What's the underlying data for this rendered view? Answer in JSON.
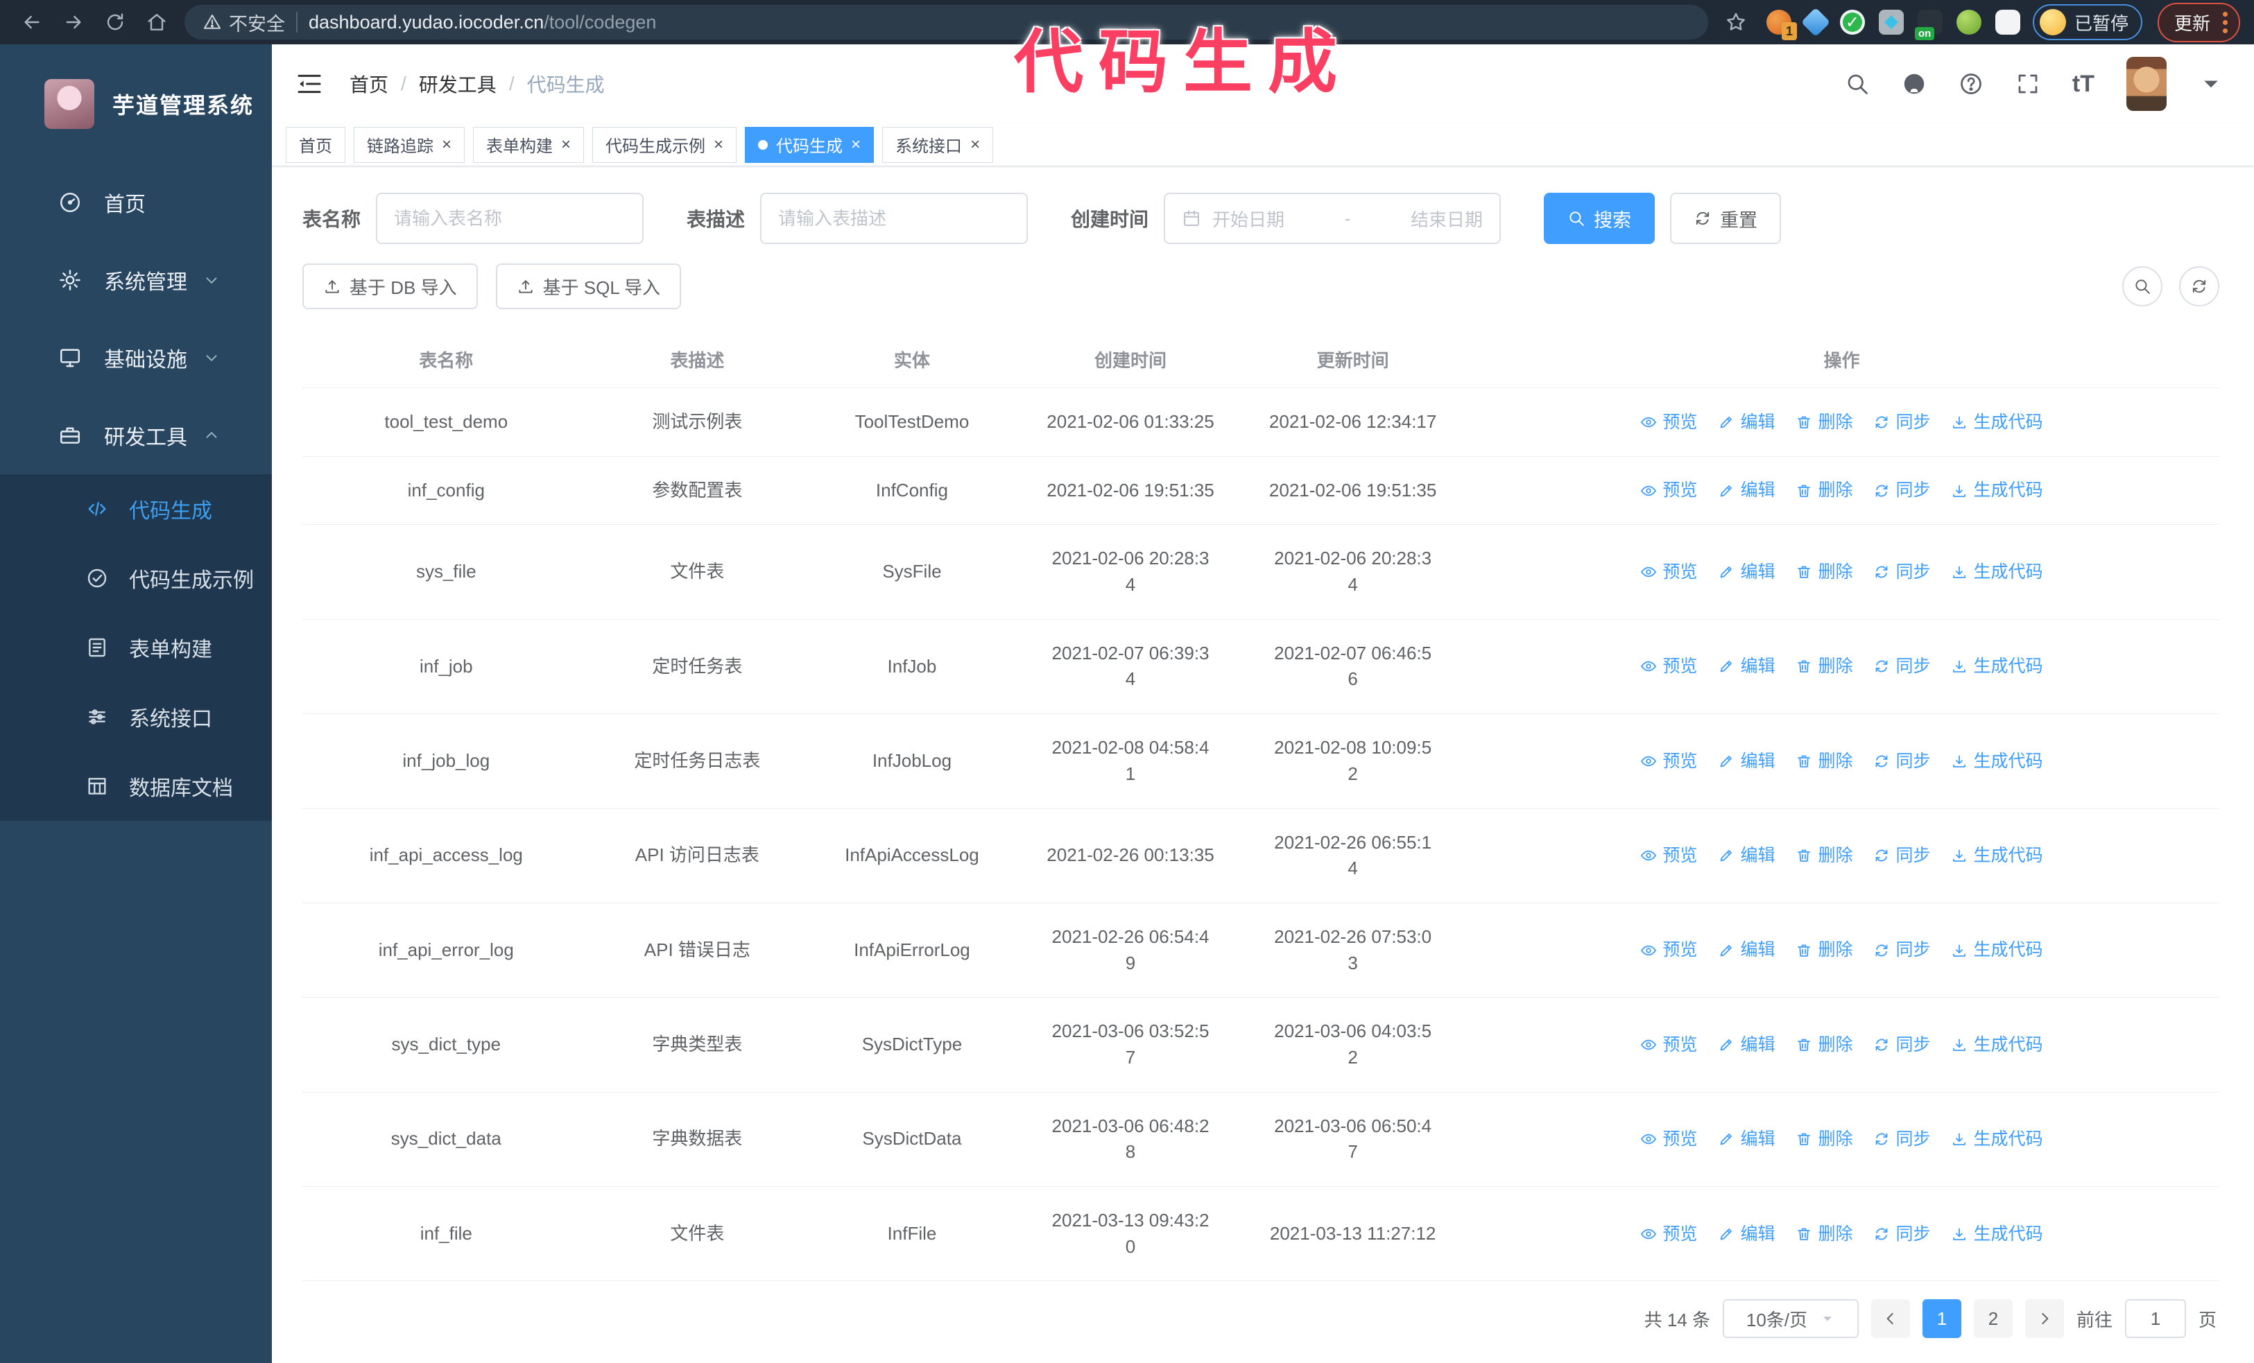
{
  "ui": {
    "close_glyph": "×",
    "breadcrumb_sep": "/",
    "font_size_icon": "tT"
  },
  "overlay": {
    "title": "代码生成",
    "color": "#fa3f63"
  },
  "browser": {
    "security_warning": "不安全",
    "url_host": "dashboard.yudao.iocoder.cn",
    "url_path": "/tool/codegen",
    "extension_badge": "1",
    "extension_on_label": "on",
    "paused_badge": "已暂停",
    "update_button": "更新"
  },
  "sidebar": {
    "logo_title": "芋道管理系统",
    "items": [
      {
        "label": "首页",
        "icon": "dashboard-icon",
        "chevron": ""
      },
      {
        "label": "系统管理",
        "icon": "gear-icon",
        "chevron": "down"
      },
      {
        "label": "基础设施",
        "icon": "monitor-icon",
        "chevron": "down"
      },
      {
        "label": "研发工具",
        "icon": "toolbox-icon",
        "chevron": "up"
      }
    ],
    "subitems": [
      {
        "label": "代码生成",
        "icon": "code-icon",
        "active": true
      },
      {
        "label": "代码生成示例",
        "icon": "example-icon",
        "active": false
      },
      {
        "label": "表单构建",
        "icon": "form-icon",
        "active": false
      },
      {
        "label": "系统接口",
        "icon": "api-icon",
        "active": false
      },
      {
        "label": "数据库文档",
        "icon": "db-doc-icon",
        "active": false
      }
    ]
  },
  "header": {
    "breadcrumb": [
      "首页",
      "研发工具",
      "代码生成"
    ]
  },
  "tabs": [
    {
      "label": "首页",
      "closable": false,
      "active": false
    },
    {
      "label": "链路追踪",
      "closable": true,
      "active": false
    },
    {
      "label": "表单构建",
      "closable": true,
      "active": false
    },
    {
      "label": "代码生成示例",
      "closable": true,
      "active": false
    },
    {
      "label": "代码生成",
      "closable": true,
      "active": true
    },
    {
      "label": "系统接口",
      "closable": true,
      "active": false
    }
  ],
  "filters": {
    "name_label": "表名称",
    "name_placeholder": "请输入表名称",
    "desc_label": "表描述",
    "desc_placeholder": "请输入表描述",
    "time_label": "创建时间",
    "start_placeholder": "开始日期",
    "range_separator": "-",
    "end_placeholder": "结束日期",
    "search_label": "搜索",
    "reset_label": "重置"
  },
  "toolbar": {
    "import_db": "基于 DB 导入",
    "import_sql": "基于 SQL 导入"
  },
  "table": {
    "columns": [
      "表名称",
      "表描述",
      "实体",
      "创建时间",
      "更新时间",
      "操作"
    ],
    "actions": [
      {
        "label": "预览",
        "icon": "eye-icon"
      },
      {
        "label": "编辑",
        "icon": "edit-icon"
      },
      {
        "label": "删除",
        "icon": "delete-icon"
      },
      {
        "label": "同步",
        "icon": "sync-icon"
      },
      {
        "label": "生成代码",
        "icon": "generate-icon"
      }
    ],
    "rows": [
      {
        "name": "tool_test_demo",
        "desc": "测试示例表",
        "entity": "ToolTestDemo",
        "created": "2021-02-06 01:33:25",
        "updated": "2021-02-06 12:34:17"
      },
      {
        "name": "inf_config",
        "desc": "参数配置表",
        "entity": "InfConfig",
        "created": "2021-02-06 19:51:35",
        "updated": "2021-02-06 19:51:35"
      },
      {
        "name": "sys_file",
        "desc": "文件表",
        "entity": "SysFile",
        "created": "2021-02-06 20:28:3\n4",
        "updated": "2021-02-06 20:28:3\n4"
      },
      {
        "name": "inf_job",
        "desc": "定时任务表",
        "entity": "InfJob",
        "created": "2021-02-07 06:39:3\n4",
        "updated": "2021-02-07 06:46:5\n6"
      },
      {
        "name": "inf_job_log",
        "desc": "定时任务日志表",
        "entity": "InfJobLog",
        "created": "2021-02-08 04:58:4\n1",
        "updated": "2021-02-08 10:09:5\n2"
      },
      {
        "name": "inf_api_access_log",
        "desc": "API 访问日志表",
        "entity": "InfApiAccessLog",
        "created": "2021-02-26 00:13:35",
        "updated": "2021-02-26 06:55:1\n4"
      },
      {
        "name": "inf_api_error_log",
        "desc": "API 错误日志",
        "entity": "InfApiErrorLog",
        "created": "2021-02-26 06:54:4\n9",
        "updated": "2021-02-26 07:53:0\n3"
      },
      {
        "name": "sys_dict_type",
        "desc": "字典类型表",
        "entity": "SysDictType",
        "created": "2021-03-06 03:52:5\n7",
        "updated": "2021-03-06 04:03:5\n2"
      },
      {
        "name": "sys_dict_data",
        "desc": "字典数据表",
        "entity": "SysDictData",
        "created": "2021-03-06 06:48:2\n8",
        "updated": "2021-03-06 06:50:4\n7"
      },
      {
        "name": "inf_file",
        "desc": "文件表",
        "entity": "InfFile",
        "created": "2021-03-13 09:43:2\n0",
        "updated": "2021-03-13 11:27:12"
      }
    ]
  },
  "pagination": {
    "total_text": "共 14 条",
    "page_size": "10条/页",
    "pages": [
      "1",
      "2"
    ],
    "active_page": "1",
    "goto_label": "前往",
    "goto_value": "1",
    "goto_suffix": "页"
  }
}
